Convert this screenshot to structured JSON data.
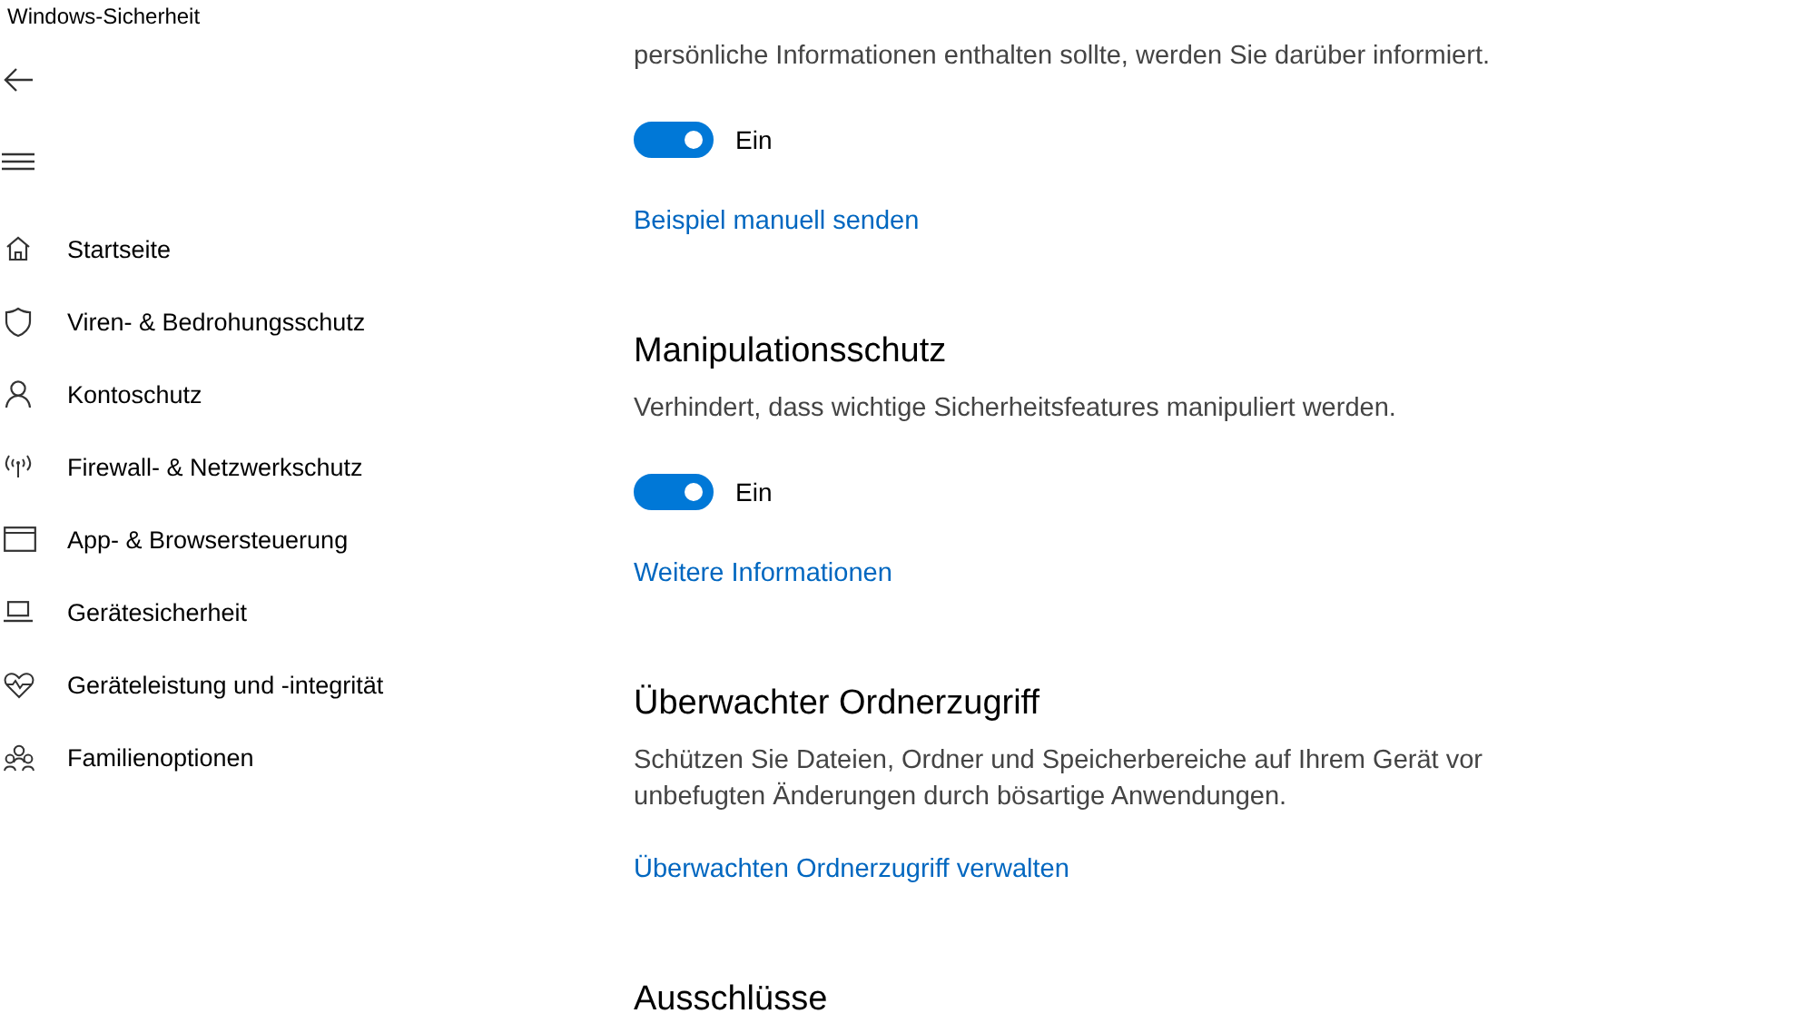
{
  "window": {
    "title": "Windows-Sicherheit"
  },
  "sidebar": {
    "items": [
      {
        "label": "Startseite"
      },
      {
        "label": "Viren- & Bedrohungsschutz"
      },
      {
        "label": "Kontoschutz"
      },
      {
        "label": "Firewall- & Netzwerkschutz"
      },
      {
        "label": "App- & Browsersteuerung"
      },
      {
        "label": "Gerätesicherheit"
      },
      {
        "label": "Geräteleistung und -integrität"
      },
      {
        "label": "Familienoptionen"
      }
    ]
  },
  "sections": [
    {
      "description": "persönliche Informationen enthalten sollte, werden Sie darüber informiert.",
      "toggle": {
        "on": true,
        "label": "Ein"
      },
      "link": "Beispiel manuell senden"
    },
    {
      "heading": "Manipulationsschutz",
      "description": "Verhindert, dass wichtige Sicherheitsfeatures manipuliert werden.",
      "toggle": {
        "on": true,
        "label": "Ein"
      },
      "link": "Weitere Informationen"
    },
    {
      "heading": "Überwachter Ordnerzugriff",
      "description": "Schützen Sie Dateien, Ordner und Speicherbereiche auf Ihrem Gerät vor unbefugten Änderungen durch bösartige Anwendungen.",
      "link": "Überwachten Ordnerzugriff verwalten"
    },
    {
      "heading": "Ausschlüsse"
    }
  ]
}
